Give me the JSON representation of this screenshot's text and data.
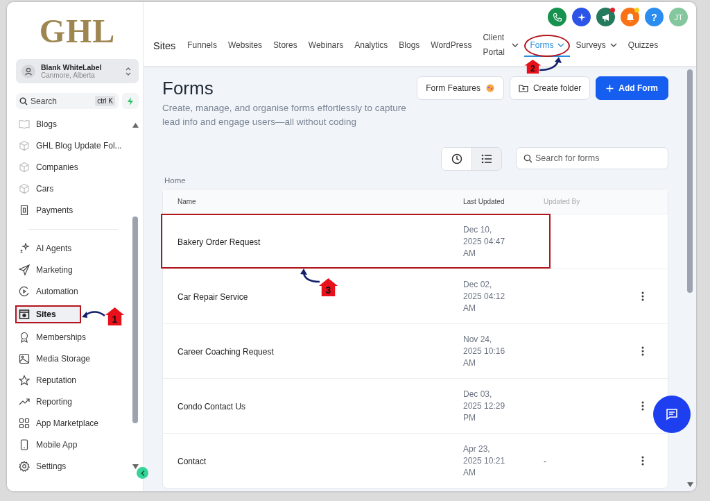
{
  "sidebar": {
    "logo": "GHL",
    "account": {
      "name": "Blank WhiteLabel",
      "location": "Canmore, Alberta"
    },
    "search": {
      "placeholder": "Search",
      "shortcut": "ctrl K"
    },
    "items": [
      {
        "label": "Blogs",
        "faded": true,
        "selected": false
      },
      {
        "label": "GHL Blog Update Fol...",
        "faded": true,
        "selected": false
      },
      {
        "label": "Companies",
        "faded": true,
        "selected": false
      },
      {
        "label": "Cars",
        "faded": true,
        "selected": false
      },
      {
        "label": "Payments",
        "faded": false,
        "selected": false
      }
    ],
    "nav": [
      {
        "label": "AI Agents",
        "selected": false
      },
      {
        "label": "Marketing",
        "selected": false
      },
      {
        "label": "Automation",
        "selected": false
      },
      {
        "label": "Sites",
        "selected": true
      },
      {
        "label": "Memberships",
        "selected": false
      },
      {
        "label": "Media Storage",
        "selected": false
      },
      {
        "label": "Reputation",
        "selected": false
      },
      {
        "label": "Reporting",
        "selected": false
      },
      {
        "label": "App Marketplace",
        "selected": false
      },
      {
        "label": "Mobile App",
        "selected": false
      }
    ],
    "settings": "Settings"
  },
  "header": {
    "help": "?",
    "avatar": "JT",
    "section": "Sites",
    "tabs": [
      {
        "label": "Funnels",
        "dropdown": false,
        "selected": false
      },
      {
        "label": "Websites",
        "dropdown": false,
        "selected": false
      },
      {
        "label": "Stores",
        "dropdown": false,
        "selected": false
      },
      {
        "label": "Webinars",
        "dropdown": false,
        "selected": false
      },
      {
        "label": "Analytics",
        "dropdown": false,
        "selected": false
      },
      {
        "label": "Blogs",
        "dropdown": false,
        "selected": false
      },
      {
        "label": "WordPress",
        "dropdown": false,
        "selected": false
      },
      {
        "label": "Client Portal",
        "dropdown": true,
        "selected": false
      },
      {
        "label": "Forms",
        "dropdown": true,
        "selected": true
      },
      {
        "label": "Surveys",
        "dropdown": true,
        "selected": false
      },
      {
        "label": "Quizzes",
        "dropdown": false,
        "selected": false
      }
    ]
  },
  "page": {
    "title": "Forms",
    "subtitle": "Create, manage, and organise forms effortlessly to capture lead info and engage users—all without coding",
    "buttons": {
      "features": "Form Features",
      "folder": "Create folder",
      "add": "Add Form"
    },
    "search": {
      "placeholder": "Search for forms"
    },
    "breadcrumb": "Home"
  },
  "table": {
    "columns": [
      "Name",
      "Last Updated",
      "Updated By"
    ],
    "rows": [
      {
        "name": "Bakery Order Request",
        "updated": "Dec 10, 2025 04:47 AM",
        "menu": false
      },
      {
        "name": "Car Repair Service",
        "updated": "Dec 02, 2025 04:12 AM",
        "menu": true
      },
      {
        "name": "Career Coaching Request",
        "updated": "Nov 24, 2025 10:16 AM",
        "menu": true
      },
      {
        "name": "Condo Contact Us",
        "updated": "Dec 03, 2025 12:29 PM",
        "menu": true
      },
      {
        "name": "Contact",
        "updated": "Apr 23, 2025 10:21 AM",
        "updated_by": "-",
        "menu": true
      }
    ]
  },
  "annotations": [
    {
      "label": "1"
    },
    {
      "label": "2"
    },
    {
      "label": "3"
    }
  ]
}
